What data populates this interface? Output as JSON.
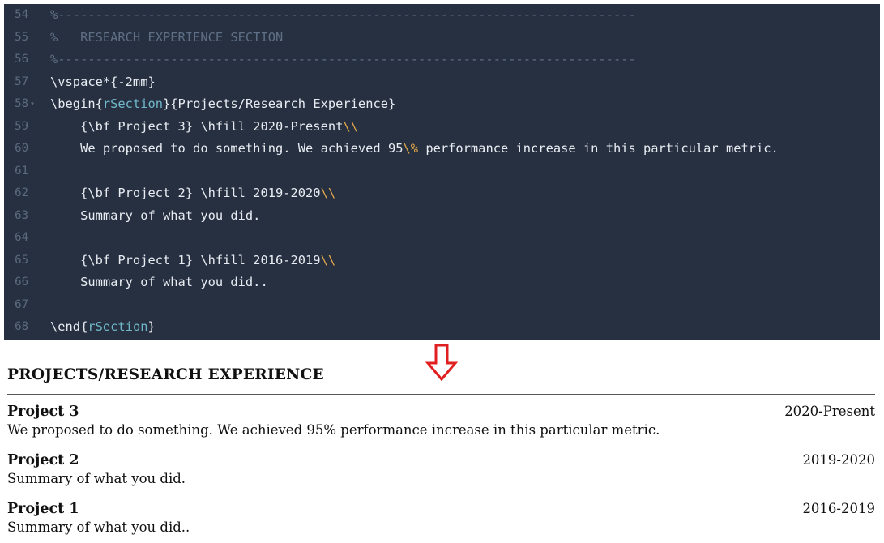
{
  "editor": {
    "lines": [
      {
        "num": "54",
        "fold": "",
        "parts": [
          {
            "t": "%-----------------------------------------------------------------------------",
            "c": "c-comment"
          }
        ]
      },
      {
        "num": "55",
        "fold": "",
        "parts": [
          {
            "t": "%   RESEARCH EXPERIENCE SECTION",
            "c": "c-comment"
          }
        ]
      },
      {
        "num": "56",
        "fold": "",
        "parts": [
          {
            "t": "%-----------------------------------------------------------------------------",
            "c": "c-comment"
          }
        ]
      },
      {
        "num": "57",
        "fold": "",
        "parts": [
          {
            "t": "\\vspace*{-2mm}",
            "c": "c-kw"
          }
        ]
      },
      {
        "num": "58",
        "fold": "▾",
        "parts": [
          {
            "t": "\\begin{",
            "c": "c-kw"
          },
          {
            "t": "rSection",
            "c": "c-env"
          },
          {
            "t": "}{Projects/Research Experience}",
            "c": "c-str"
          }
        ]
      },
      {
        "num": "59",
        "fold": "",
        "parts": [
          {
            "t": "    {\\bf Project 3} \\hfill 2020-Present",
            "c": "c-str"
          },
          {
            "t": "\\\\",
            "c": "c-esc"
          }
        ]
      },
      {
        "num": "60",
        "fold": "",
        "parts": [
          {
            "t": "    We proposed to do something. We achieved 95",
            "c": "c-str"
          },
          {
            "t": "\\%",
            "c": "c-esc"
          },
          {
            "t": " performance increase in this particular metric.",
            "c": "c-str"
          }
        ]
      },
      {
        "num": "61",
        "fold": "",
        "parts": []
      },
      {
        "num": "62",
        "fold": "",
        "parts": [
          {
            "t": "    {\\bf Project 2} \\hfill 2019-2020",
            "c": "c-str"
          },
          {
            "t": "\\\\",
            "c": "c-esc"
          }
        ]
      },
      {
        "num": "63",
        "fold": "",
        "parts": [
          {
            "t": "    Summary of what you did.",
            "c": "c-str"
          }
        ]
      },
      {
        "num": "64",
        "fold": "",
        "parts": []
      },
      {
        "num": "65",
        "fold": "",
        "parts": [
          {
            "t": "    {\\bf Project 1} \\hfill 2016-2019",
            "c": "c-str"
          },
          {
            "t": "\\\\",
            "c": "c-esc"
          }
        ]
      },
      {
        "num": "66",
        "fold": "",
        "parts": [
          {
            "t": "    Summary of what you did..",
            "c": "c-str"
          }
        ]
      },
      {
        "num": "67",
        "fold": "",
        "parts": []
      },
      {
        "num": "68",
        "fold": "",
        "parts": [
          {
            "t": "\\end{",
            "c": "c-kw"
          },
          {
            "t": "rSection",
            "c": "c-env"
          },
          {
            "t": "}",
            "c": "c-kw"
          }
        ]
      }
    ]
  },
  "arrow": {
    "icon": "down-arrow-icon",
    "color": "#e02020"
  },
  "document": {
    "section_title": "PROJECTS/RESEARCH EXPERIENCE",
    "entries": [
      {
        "name": "Project 3",
        "date": "2020-Present",
        "desc": "We proposed to do something.  We achieved 95% performance increase in this particular metric."
      },
      {
        "name": "Project 2",
        "date": "2019-2020",
        "desc": "Summary of what you did."
      },
      {
        "name": "Project 1",
        "date": "2016-2019",
        "desc": "Summary of what you did.."
      }
    ]
  }
}
